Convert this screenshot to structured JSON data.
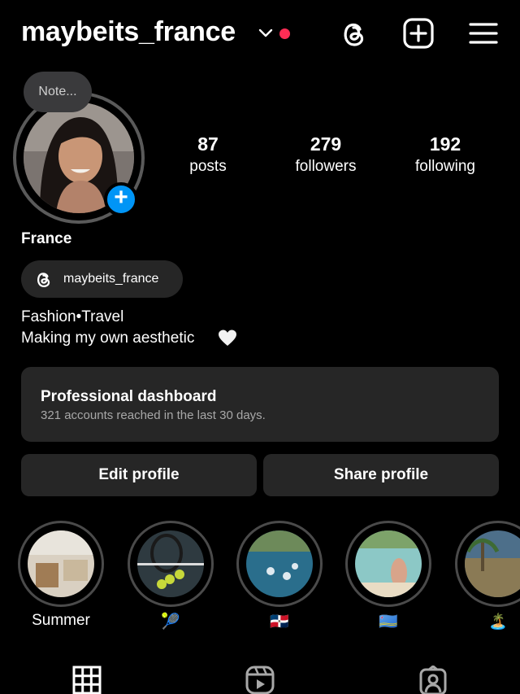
{
  "header": {
    "username": "maybeits_france",
    "icons": [
      "chevron-down-icon",
      "notification-dot",
      "threads-icon",
      "create-post-icon",
      "menu-icon"
    ]
  },
  "profile": {
    "note": "Note...",
    "stats": [
      {
        "value": "87",
        "label": "posts"
      },
      {
        "value": "279",
        "label": "followers"
      },
      {
        "value": "192",
        "label": "following"
      }
    ],
    "name": "France",
    "threads_handle": "maybeits_france",
    "bio_line1": "Fashion•Travel",
    "bio_line2": "Making my own aesthetic"
  },
  "dashboard": {
    "title": "Professional dashboard",
    "subtitle": "321 accounts reached in the last 30 days."
  },
  "actions": {
    "edit_label": "Edit profile",
    "share_label": "Share profile"
  },
  "highlights": [
    {
      "label": "Summer"
    },
    {
      "label": "🎾"
    },
    {
      "label": "🇩🇴"
    },
    {
      "label": "🇦🇼"
    },
    {
      "label": "🏝️"
    }
  ],
  "tabs": [
    "grid-icon",
    "reels-icon",
    "tagged-icon"
  ],
  "colors": {
    "background": "#000000",
    "surface": "#262626",
    "accent_blue": "#0095f6",
    "notification_red": "#ff2d55",
    "secondary_text": "#a8a8a8"
  }
}
